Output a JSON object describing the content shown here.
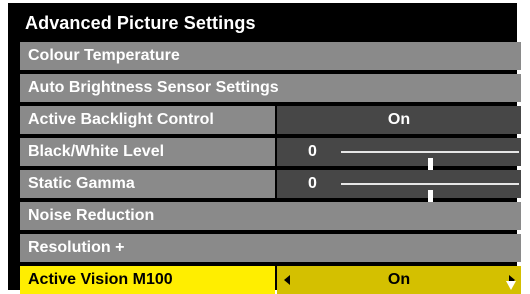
{
  "menu": {
    "title": "Advanced Picture Settings",
    "items": [
      {
        "label": "Colour Temperature"
      },
      {
        "label": "Auto Brightness Sensor Settings"
      },
      {
        "label": "Active Backlight Control",
        "value": "On"
      },
      {
        "label": "Black/White Level",
        "value": "0",
        "slider_level": 0.5
      },
      {
        "label": "Static Gamma",
        "value": "0",
        "slider_level": 0.5
      },
      {
        "label": "Noise Reduction"
      },
      {
        "label": "Resolution +"
      },
      {
        "label": "Active Vision M100",
        "value": "On",
        "selected": true
      }
    ]
  },
  "icons": {
    "scroll_up": "triangle-up-icon",
    "scroll_down": "triangle-down-icon",
    "value_left": "triangle-left-icon",
    "value_right": "triangle-right-icon"
  },
  "colors": {
    "background": "#000000",
    "item_background": "#8a8a8a",
    "value_background": "#474747",
    "selected_label": "#ffee00",
    "selected_value": "#d4c000",
    "text": "#ffffff"
  }
}
